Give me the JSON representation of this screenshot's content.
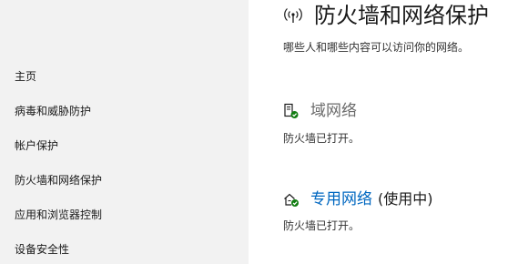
{
  "sidebar": {
    "items": [
      {
        "label": "主页"
      },
      {
        "label": "病毒和威胁防护"
      },
      {
        "label": "帐户保护"
      },
      {
        "label": "防火墙和网络保护"
      },
      {
        "label": "应用和浏览器控制"
      },
      {
        "label": "设备安全性"
      }
    ]
  },
  "main": {
    "title": "防火墙和网络保护",
    "title_icon": "wifi-signal-icon",
    "subtitle": "哪些人和哪些内容可以访问你的网络。",
    "networks": [
      {
        "name": "域网络",
        "suffix": "",
        "status": "防火墙已打开。",
        "icon": "domain-network-icon"
      },
      {
        "name": "专用网络",
        "suffix": "(使用中)",
        "status": "防火墙已打开。",
        "icon": "private-network-icon"
      }
    ]
  },
  "colors": {
    "sidebar_bg": "#f2f2f2",
    "link_blue": "#0067c0",
    "check_green": "#107c10"
  }
}
